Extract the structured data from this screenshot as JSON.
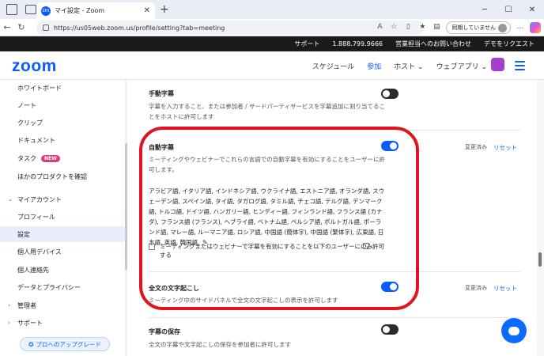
{
  "browser": {
    "tab_title": "マイ設定 - Zoom",
    "tab_favicon": "zm",
    "url": "https://us05web.zoom.us/profile/setting?tab=meeting",
    "sync_label": "同期していません"
  },
  "topbar": {
    "items": [
      "サポート",
      "1.888.799.9666",
      "営業担当へのお問い合わせ",
      "デモをリクエスト"
    ]
  },
  "header": {
    "logo": "zoom",
    "nav": [
      "スケジュール",
      "参加",
      "ホスト",
      "ウェブアプリ"
    ]
  },
  "sidebar": {
    "items": [
      {
        "label": "ホワイトボード"
      },
      {
        "label": "ノート"
      },
      {
        "label": "クリップ"
      },
      {
        "label": "ドキュメント"
      },
      {
        "label": "タスク",
        "badge": "NEW"
      },
      {
        "label": "ほかのプロダクトを確認"
      },
      {
        "label": "マイアカウント"
      },
      {
        "label": "プロフィール"
      },
      {
        "label": "設定"
      },
      {
        "label": "個人用デバイス"
      },
      {
        "label": "個人連絡先"
      },
      {
        "label": "データとプライバシー"
      },
      {
        "label": "管理者"
      },
      {
        "label": "サポート"
      }
    ],
    "upgrade": "プロへのアップグレード"
  },
  "settings": {
    "manual_caption": {
      "title": "手動字幕",
      "desc": "字幕を入力すること、または参加者 / サードパーティサービスを字幕追加に割り当てることをホストに許可します",
      "enabled": false
    },
    "auto_caption": {
      "title": "自動字幕",
      "desc": "ミーティングやウェビナーでこれらの言語での自動字幕を有効にすることをユーザーに許可します。",
      "languages": "アラビア語, イタリア語, インドネシア語, ウクライナ語, エストニア語, オランダ語, スウェーデン語, スペイン語, タイ語, タガログ語, タミル語, チェコ語, テルグ語, デンマーク語, トルコ語, ドイツ語, ハンガリー語, ヒンディー語, フィンランド語, フランス語 (カナダ), フランス語 (フランス), ヘブライ語, ベトナム語, ペルシア語, ポルトガル語, ポーランド語, マレー語, ルーマニア語, ロシア語, 中国語 (簡体字), 中国語 (繁体字), 広東語, 日本語, 英語, 韓国語",
      "checkbox_label": "ミーティングまたはウェビナーで字幕を有効にすることを以下のユーザーにのみ許可する",
      "enabled": true,
      "modified": "変更済み",
      "reset": "リセット"
    },
    "full_transcript": {
      "title": "全文の文字起こし",
      "desc": "ミーティング中のサイドパネルで全文の文字起こしの表示を許可します",
      "enabled": true,
      "modified": "変更済み",
      "reset": "リセット"
    },
    "save_caption": {
      "title": "字幕の保存",
      "desc": "全文の字幕や文字起こしの保存を参加者に許可します",
      "enabled": false
    }
  },
  "colors": {
    "accent": "#0b5cff",
    "annotation": "#e0141e"
  }
}
